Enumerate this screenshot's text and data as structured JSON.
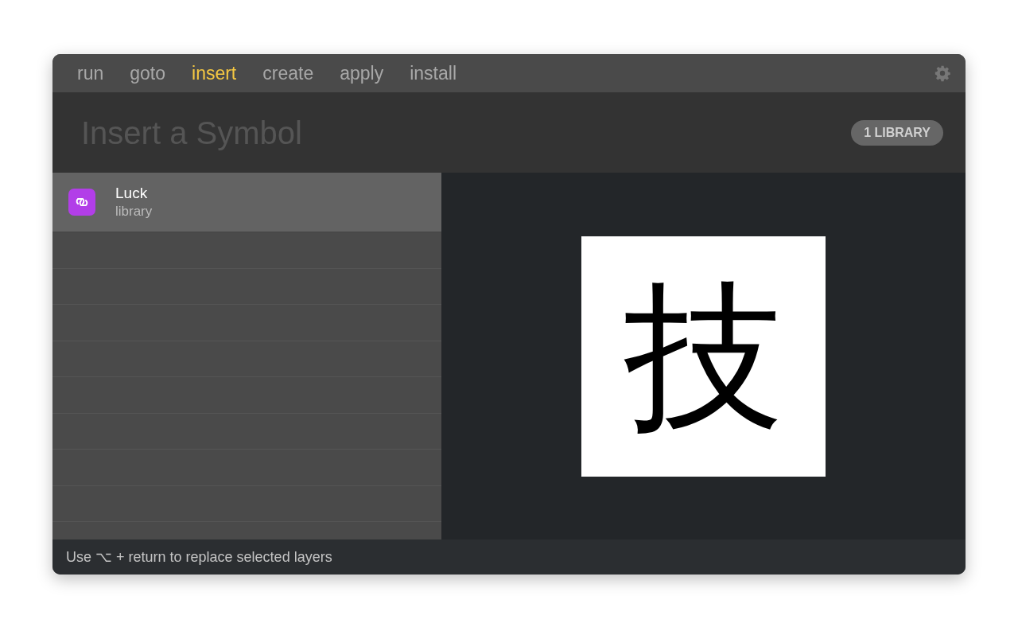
{
  "tabs": [
    {
      "label": "run",
      "selected": false
    },
    {
      "label": "goto",
      "selected": false
    },
    {
      "label": "insert",
      "selected": true
    },
    {
      "label": "create",
      "selected": false
    },
    {
      "label": "apply",
      "selected": false
    },
    {
      "label": "install",
      "selected": false
    }
  ],
  "search": {
    "placeholder": "Insert a Symbol"
  },
  "badge": "1 LIBRARY",
  "results": [
    {
      "title": "Luck",
      "subtitle": "library",
      "selected": true
    }
  ],
  "preview": {
    "symbol": "技"
  },
  "footer": "Use ⌥ + return to replace selected layers"
}
